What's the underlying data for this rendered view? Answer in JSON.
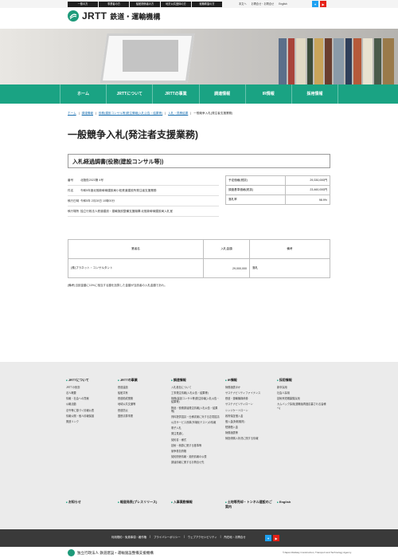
{
  "header": {
    "audience": [
      "一般の方",
      "事業者の方",
      "船舶関係者の方",
      "地方公共団体の方",
      "就職希望の方"
    ],
    "util": [
      "本文へ",
      "お問合せ・お問合せ",
      "English"
    ],
    "sns": [
      {
        "name": "twitter-icon",
        "color": "#1da1f2"
      },
      {
        "name": "youtube-icon",
        "color": "#e62117"
      }
    ],
    "logo_text": "JRTT",
    "logo_jp": "鉄道・運輸機構"
  },
  "nav": [
    "ホーム",
    "JRTTについて",
    "JRTTの事業",
    "調達情報",
    "IR情報",
    "採用情報"
  ],
  "breadcrumb": [
    "ホーム",
    "調達情報",
    "役務(建設コンサル等)発注情報(入札公告・結果等)",
    "入札・見積結果",
    "一般競争入札(発注者支援業務)"
  ],
  "title": "一般競争入札(発注者支援業務)",
  "section_title": "入札経過調書(役務(建設コンサル等))",
  "info": [
    {
      "label": "番号",
      "value": "北陸役2023第 4号"
    },
    {
      "label": "件名",
      "value": "令和5年度北陸新幹線建設局小松鉄道建設所発注者支援業務"
    },
    {
      "label": "執行日時",
      "value": "令和5年 2月28日 10時00分"
    },
    {
      "label": "執行場所",
      "value": "独立行政法人鉄道建設・運輸施設整備支援機構 北陸新幹線建設局入札室"
    }
  ],
  "price": [
    {
      "label": "予定価格(税抜)",
      "value": "29,330,000円"
    },
    {
      "label": "調査基準価格(税抜)",
      "value": "23,460,000円"
    },
    {
      "label": "落札率",
      "value": "98.9%"
    }
  ],
  "bid_table": {
    "headers": [
      "業者名",
      "入札金額",
      "備考"
    ],
    "rows": [
      {
        "company": "(株)プラネット・コンサルタント",
        "amount": "29,000,000",
        "note": "落札"
      }
    ]
  },
  "note": "(備考)当該金額に10%に相当する額を加算した金額が当該者の入札金額であれ。",
  "footer": {
    "columns": [
      {
        "title": "JRTTについて",
        "items": [
          "JRTTの役割",
          "法人概要",
          "情報・社会への貢献",
          "公報活動",
          "法令等に基づく情報公表",
          "情報公開・個人情報保護",
          "関連リンク"
        ]
      },
      {
        "title": "JRTTの事業",
        "items": [
          "鉄道建設",
          "船舶共有",
          "鉄道助成業務",
          "地域公共交通等",
          "鉄道防災",
          "国鉄清算事業"
        ]
      },
      {
        "title": "調達情報",
        "items": [
          "入札参加について",
          "工事発注情報(入札公告・結果等)",
          "役務(建設コンサル等)発注情報(入札公告・結果等)",
          "物品・役務調達発注情報(入札公告・結果等)",
          "資料提供招請・仕様書案に対する意見招請",
          "公共サービス改革(市場化テスト)の情報",
          "電子入札",
          "発注見通し",
          "契約書・様式",
          "技術・積算に関する基準等",
          "競争参加資格",
          "契約関係情報・契約情報の公表",
          "調達情報に関するお問合せ先"
        ]
      },
      {
        "title": "IR情報",
        "items": [
          "財務諸表ほか",
          "サステナビリティファイナンス",
          "鉄道・運輸機構債券",
          "サステナビリティローン",
          "シンジケートローン",
          "政府保証借入金",
          "借入金(財政融資)",
          "短期借入金",
          "財務諸表等",
          "財投債購入状況に関する情報"
        ]
      },
      {
        "title": "採用情報",
        "items": [
          "新卒採用",
          "社会人採用",
          "技術系短期募集採用",
          "カムバック採用(退職後再度応募される皆様へ)"
        ]
      }
    ],
    "row2": [
      "お知らせ",
      "報道発表(プレスリリース)",
      "入事異動情報",
      "土地等売却・トンネル建設のご案内",
      "English"
    ]
  },
  "footer_bar": {
    "links": [
      "利用規約・免責事項・著作権",
      "プライバシーポリシー",
      "ウェブアクセシビリティ",
      "所在地・お問合せ"
    ]
  },
  "bottom": {
    "name": "独立行政法人 鉄道建設・運輸施設整備支援機構",
    "copyright": "©Japan Railway Construction, Transport and Technology Agency."
  }
}
